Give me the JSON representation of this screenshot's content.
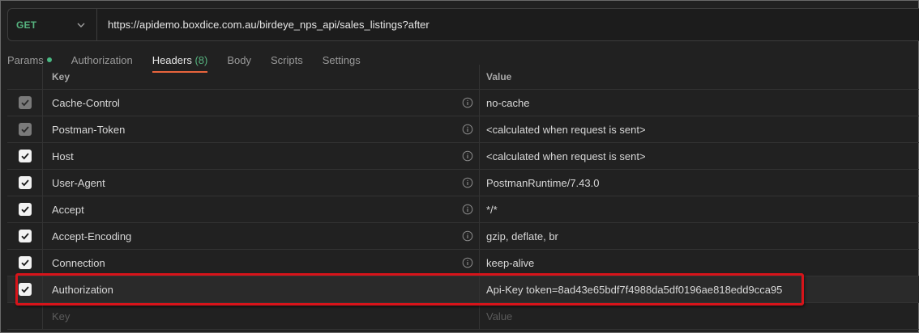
{
  "request": {
    "method": "GET",
    "url": "https://apidemo.boxdice.com.au/birdeye_nps_api/sales_listings?after"
  },
  "tabs": [
    {
      "label": "Params",
      "has_dot": true
    },
    {
      "label": "Authorization"
    },
    {
      "label": "Headers",
      "count": "(8)",
      "active": true
    },
    {
      "label": "Body"
    },
    {
      "label": "Scripts"
    },
    {
      "label": "Settings"
    }
  ],
  "headers_table": {
    "columns": {
      "key": "Key",
      "value": "Value"
    },
    "rows": [
      {
        "key": "Cache-Control",
        "value": "no-cache",
        "checked": true,
        "locked": true
      },
      {
        "key": "Postman-Token",
        "value": "<calculated when request is sent>",
        "checked": true,
        "locked": true
      },
      {
        "key": "Host",
        "value": "<calculated when request is sent>",
        "checked": true,
        "locked": false
      },
      {
        "key": "User-Agent",
        "value": "PostmanRuntime/7.43.0",
        "checked": true,
        "locked": false
      },
      {
        "key": "Accept",
        "value": "*/*",
        "checked": true,
        "locked": false
      },
      {
        "key": "Accept-Encoding",
        "value": "gzip, deflate, br",
        "checked": true,
        "locked": false
      },
      {
        "key": "Connection",
        "value": "keep-alive",
        "checked": true,
        "locked": false
      },
      {
        "key": "Authorization",
        "value": "Api-Key token=8ad43e65bdf7f4988da5df0196ae818edd9cca95",
        "checked": true,
        "locked": false
      }
    ],
    "placeholder": {
      "key": "Key",
      "value": "Value"
    }
  },
  "colors": {
    "method_get": "#56b37f",
    "active_tab_underline": "#e8643c",
    "highlight_border": "#d7141a"
  }
}
